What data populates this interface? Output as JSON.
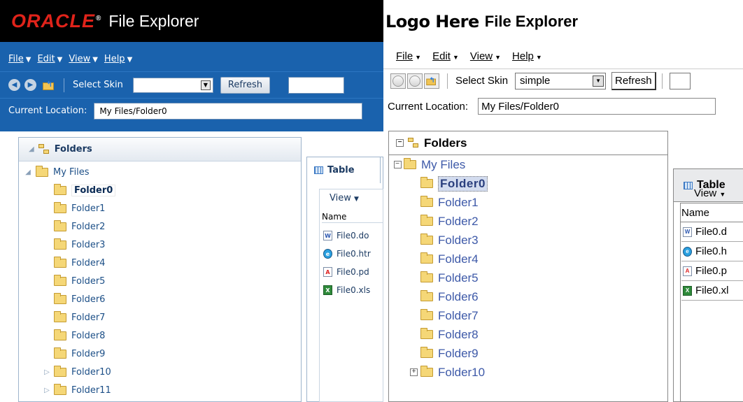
{
  "left": {
    "logo": "ORACLE",
    "logo_mark": "®",
    "app_title": "File Explorer",
    "menus": [
      {
        "label": "File"
      },
      {
        "label": "Edit"
      },
      {
        "label": "View"
      },
      {
        "label": "Help"
      }
    ],
    "toolbar": {
      "skin_label": "Select Skin",
      "skin_value": "",
      "refresh_label": "Refresh"
    },
    "location": {
      "label": "Current Location:",
      "value": "My Files/Folder0"
    },
    "tree": {
      "title": "Folders",
      "root": "My Files",
      "selected": "Folder0",
      "folders": [
        "Folder1",
        "Folder2",
        "Folder3",
        "Folder4",
        "Folder5",
        "Folder6",
        "Folder7",
        "Folder8",
        "Folder9"
      ],
      "collapsed": [
        "Folder10",
        "Folder11"
      ]
    },
    "table": {
      "tab_label": "Table",
      "view_label": "View",
      "col_name": "Name",
      "files": [
        {
          "name": "File0.do",
          "type": "doc"
        },
        {
          "name": "File0.htr",
          "type": "htm"
        },
        {
          "name": "File0.pd",
          "type": "pdf"
        },
        {
          "name": "File0.xls",
          "type": "xls"
        }
      ]
    }
  },
  "right": {
    "logo": "Logo Here",
    "app_title": "File Explorer",
    "menus": [
      {
        "label": "File"
      },
      {
        "label": "Edit"
      },
      {
        "label": "View"
      },
      {
        "label": "Help"
      }
    ],
    "toolbar": {
      "skin_label": "Select Skin",
      "skin_value": "simple",
      "refresh_label": "Refresh"
    },
    "location": {
      "label": "Current Location:",
      "value": "My Files/Folder0"
    },
    "tree": {
      "title": "Folders",
      "root": "My Files",
      "selected": "Folder0",
      "folders": [
        "Folder1",
        "Folder2",
        "Folder3",
        "Folder4",
        "Folder5",
        "Folder6",
        "Folder7",
        "Folder8",
        "Folder9"
      ],
      "collapsed": [
        "Folder10"
      ]
    },
    "table": {
      "tab_label": "Table",
      "view_label": "View",
      "col_name": "Name",
      "files": [
        {
          "name": "File0.d",
          "type": "doc"
        },
        {
          "name": "File0.h",
          "type": "htm"
        },
        {
          "name": "File0.p",
          "type": "pdf"
        },
        {
          "name": "File0.xl",
          "type": "xls"
        }
      ]
    }
  },
  "icons": {
    "file_types": {
      "doc": "W",
      "htm": "e",
      "pdf": "A",
      "xls": "X"
    }
  },
  "colors": {
    "oracle_red": "#e0231a",
    "oracle_blue": "#1a62ad",
    "tree_link": "#3d59a8"
  }
}
